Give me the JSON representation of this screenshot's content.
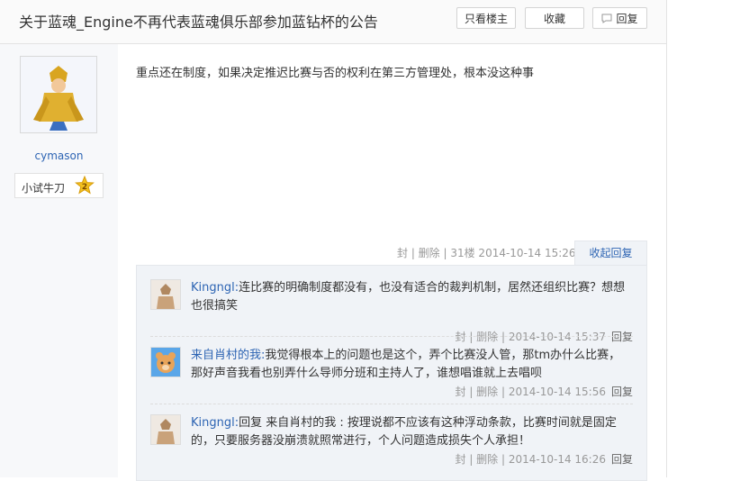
{
  "header": {
    "title": "关于蓝魂_Engine不再代表蓝魂俱乐部参加蓝钻杯的公告",
    "buttons": {
      "only_op": "只看楼主",
      "favorite": "收藏",
      "reply": "回复"
    }
  },
  "author": {
    "name": "cymason",
    "level_name": "小试牛刀",
    "level_num": "2"
  },
  "post": {
    "content": "重点还在制度，如果决定推迟比赛与否的权利在第三方管理处，根本没这种事",
    "meta": "封 | 删除 | 31楼  2014-10-14 15:26",
    "collapse_label": "收起回复"
  },
  "replies": [
    {
      "user": "Kingngl:",
      "text": "连比赛的明确制度都没有，也没有适合的裁判机制，居然还组织比赛？想想也很搞笑",
      "meta": "封 | 删除 | 2014-10-14 15:37",
      "reply_label": "回复"
    },
    {
      "user": "来自肖村的我:",
      "text": "我觉得根本上的问题也是这个，弄个比赛没人管，那tm办什么比赛，那好声音我看也别弄什么导师分班和主持人了，谁想唱谁就上去唱呗",
      "meta": "封 | 删除 | 2014-10-14 15:56",
      "reply_label": "回复"
    },
    {
      "user": "Kingngl:",
      "text": "回复 来自肖村的我 : 按理说都不应该有这种浮动条款，比赛时间就是固定的，只要服务器没崩溃就照常进行，个人问题造成损失个人承担！",
      "meta": "封 | 删除 | 2014-10-14 16:26",
      "reply_label": "回复"
    }
  ]
}
